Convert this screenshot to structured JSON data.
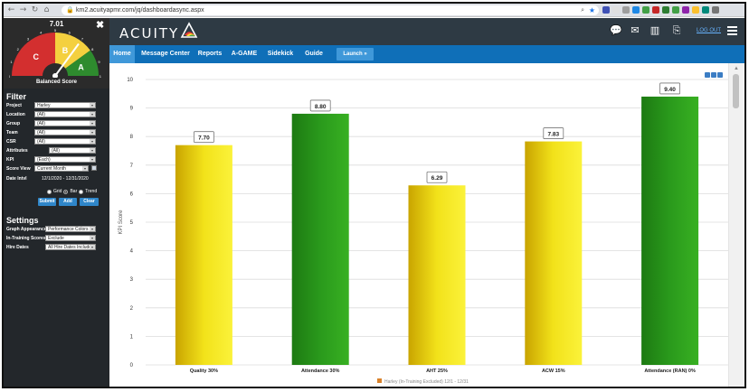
{
  "browser": {
    "url": "km2.acuityapmr.com/jq/dashboardasync.aspx",
    "lock_icon": "lock-icon",
    "zoom_icon": "zoom-icon",
    "star_icon": "star-icon",
    "extension_colors": [
      "#3f51b5",
      "#e0e0e0",
      "#9e9e9e",
      "#1e88e5",
      "#43a047",
      "#c62828",
      "#2e7d32",
      "#43a047",
      "#8e24aa",
      "#fbc02d",
      "#00897b",
      "#757575"
    ]
  },
  "gauge": {
    "value": "7.01",
    "caption": "Balanced Score",
    "close_label": "✖",
    "zones": [
      "C",
      "B",
      "A"
    ],
    "ticks": [
      "0",
      "1",
      "2",
      "3",
      "4",
      "5",
      "6",
      "7",
      "8",
      "9",
      "10"
    ],
    "needle": 7.01,
    "colors": {
      "c": "#d32f2f",
      "b": "#f4d03f",
      "a": "#2e8b2e"
    }
  },
  "filter": {
    "title": "Filter",
    "fields": [
      {
        "label": "Project",
        "value": "Harley"
      },
      {
        "label": "Location",
        "value": "(All)"
      },
      {
        "label": "Group",
        "value": "(All)"
      },
      {
        "label": "Team",
        "value": "(All)"
      },
      {
        "label": "CSR",
        "value": "(All)"
      },
      {
        "label": "Attributes",
        "value": "(All)"
      },
      {
        "label": "KPI",
        "value": "(Each)"
      },
      {
        "label": "Score View",
        "value": "Current Month"
      }
    ],
    "date_label": "Date Intvl",
    "date_value": "12/1/2020 - 12/31/2020",
    "radios": [
      "Grid",
      "Bar",
      "Trend"
    ],
    "selected_radio": "Bar",
    "buttons": [
      "Submit",
      "Add",
      "Clear"
    ]
  },
  "settings": {
    "title": "Settings",
    "fields": [
      {
        "label": "Graph Appearance",
        "value": "Performance Colors"
      },
      {
        "label": "In-Training Scores",
        "value": "Exclude"
      },
      {
        "label": "Hire Dates",
        "value": "All Hire Dates Included"
      }
    ]
  },
  "header": {
    "logo_text": "ACUITY",
    "logout_label": "LOG OUT",
    "icons": [
      "chat-icon",
      "mail-icon",
      "bar-chart-icon",
      "export-icon",
      "menu-icon"
    ]
  },
  "nav": {
    "items": [
      "Home",
      "Message Center",
      "Reports",
      "A-GAME",
      "Sidekick",
      "Guide"
    ],
    "active": "Home",
    "launch_label": "Launch »"
  },
  "chart_data": {
    "type": "bar",
    "categories": [
      "Quality 30%",
      "Attendance 30%",
      "AHT 25%",
      "ACW 15%",
      "Attendance (RAN) 0%"
    ],
    "values": [
      7.7,
      8.8,
      6.29,
      7.83,
      9.4
    ],
    "value_labels": [
      "7.70",
      "8.80",
      "6.29",
      "7.83",
      "9.40"
    ],
    "bar_colors": [
      "yellow",
      "green",
      "yellow",
      "yellow",
      "green"
    ],
    "ylabel": "KPI Score",
    "ylim": [
      0,
      10
    ],
    "yticks": [
      "0",
      "1",
      "2",
      "3",
      "4",
      "5",
      "6",
      "7",
      "8",
      "9",
      "10"
    ],
    "legend": "Harley (In-Training Excluded) 12/1 - 12/31",
    "legend_color": "#d9822b",
    "grid": true
  }
}
